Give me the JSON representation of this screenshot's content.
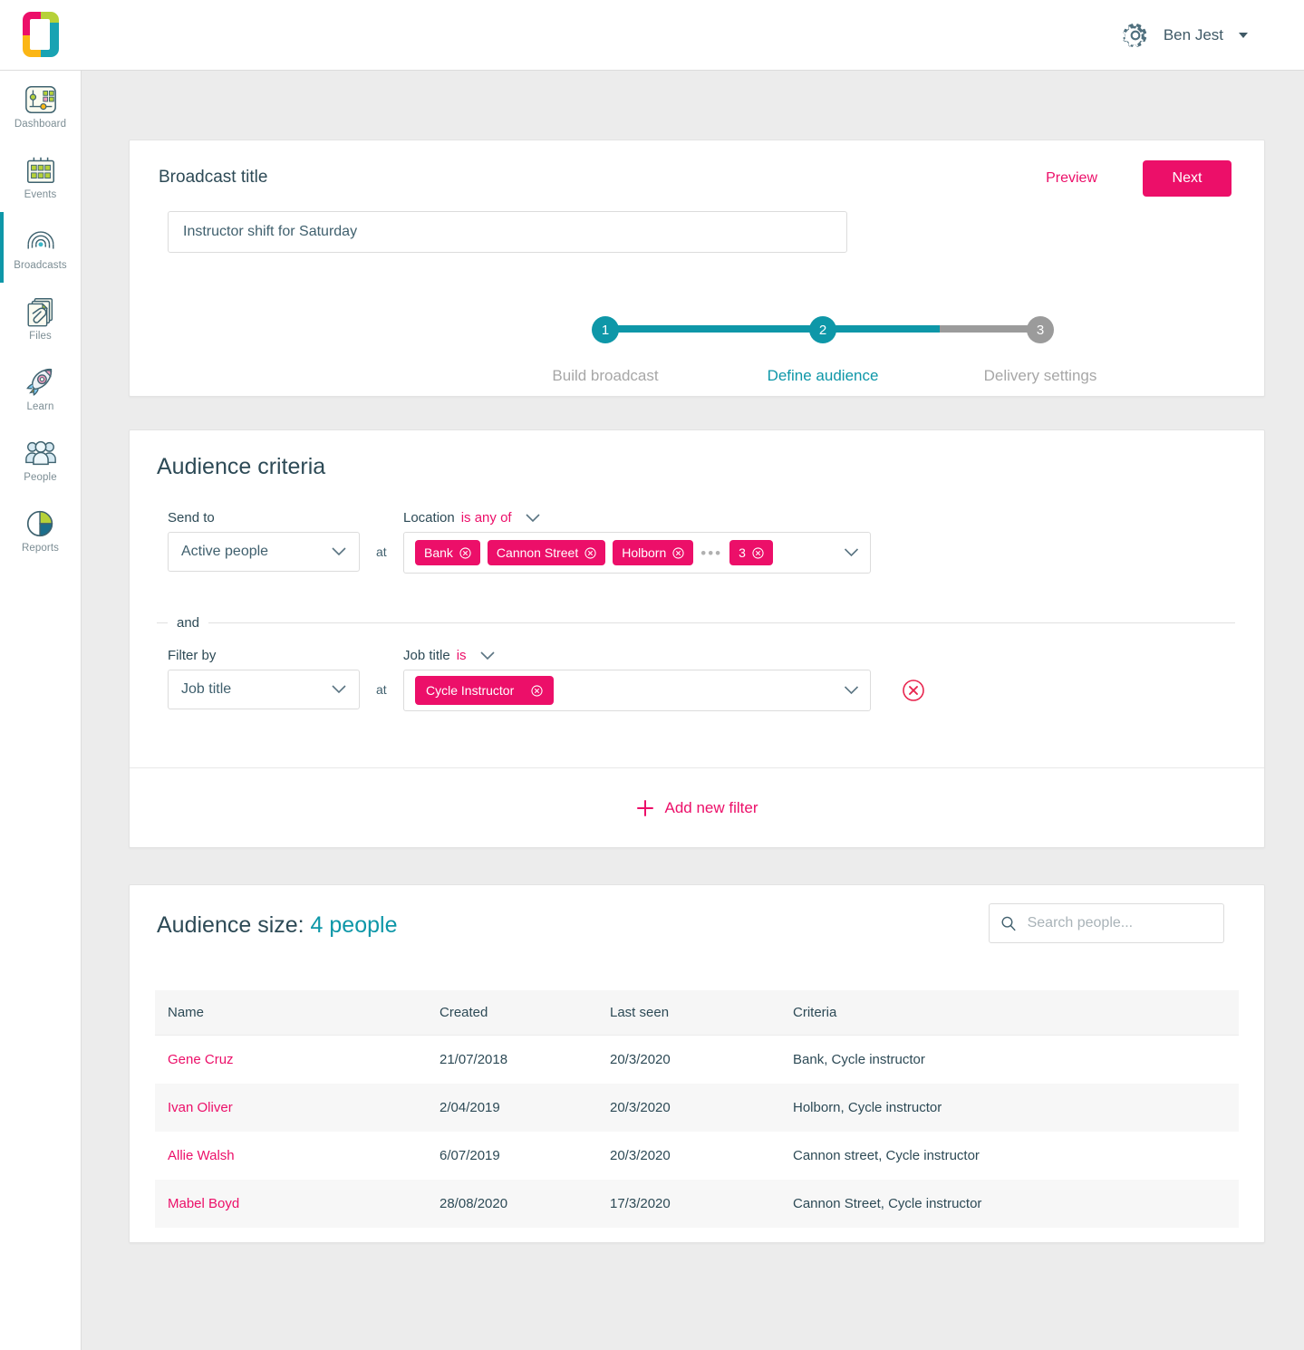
{
  "header": {
    "logo_name": "app-logo",
    "gear_icon": "gear-icon",
    "username": "Ben Jest"
  },
  "sidebar": {
    "items": [
      {
        "label": "Dashboard",
        "icon": "dashboard-icon",
        "active": false
      },
      {
        "label": "Events",
        "icon": "calendar-icon",
        "active": false
      },
      {
        "label": "Broadcasts",
        "icon": "broadcast-icon",
        "active": true
      },
      {
        "label": "Files",
        "icon": "files-icon",
        "active": false
      },
      {
        "label": "Learn",
        "icon": "rocket-icon",
        "active": false
      },
      {
        "label": "People",
        "icon": "people-icon",
        "active": false
      },
      {
        "label": "Reports",
        "icon": "pie-chart-icon",
        "active": false
      }
    ]
  },
  "broadcast": {
    "title_label": "Broadcast title",
    "title_value": "Instructor shift for Saturday",
    "title_placeholder": "Broadcast title",
    "preview_label": "Preview",
    "next_label": "Next",
    "steps": [
      {
        "number": "1",
        "label": "Build broadcast",
        "state": "complete"
      },
      {
        "number": "2",
        "label": "Define audience",
        "state": "current"
      },
      {
        "number": "3",
        "label": "Delivery settings",
        "state": "upcoming"
      }
    ]
  },
  "criteria": {
    "section_title": "Audience criteria",
    "and_text": "and",
    "at_text": "at",
    "add_filter_label": "Add new filter",
    "rows": [
      {
        "label": "Send to",
        "select_value": "Active people",
        "operator_field": "Location",
        "operator_value": "is any of",
        "chips": [
          "Bank",
          "Cannon Street",
          "Holborn"
        ],
        "overflow_dots": "•••",
        "overflow_count": "3",
        "removable": false
      },
      {
        "label": "Filter by",
        "select_value": "Job title",
        "operator_field": "Job title",
        "operator_value": "is",
        "chips": [
          "Cycle Instructor"
        ],
        "removable": true
      }
    ]
  },
  "audience": {
    "title_prefix": "Audience size: ",
    "count_text": "4 people",
    "search_placeholder": "Search people...",
    "search_value": "",
    "columns": [
      "Name",
      "Created",
      "Last seen",
      "Criteria"
    ],
    "rows": [
      {
        "name": "Gene Cruz",
        "created": "21/07/2018",
        "last_seen": "20/3/2020",
        "criteria": "Bank, Cycle instructor"
      },
      {
        "name": "Ivan Oliver",
        "created": "2/04/2019",
        "last_seen": "20/3/2020",
        "criteria": "Holborn, Cycle instructor"
      },
      {
        "name": "Allie Walsh",
        "created": "6/07/2019",
        "last_seen": "20/3/2020",
        "criteria": "Cannon street, Cycle instructor"
      },
      {
        "name": "Mabel Boyd",
        "created": "28/08/2020",
        "last_seen": "17/3/2020",
        "criteria": "Cannon Street, Cycle instructor"
      }
    ]
  },
  "colors": {
    "accent_pink": "#ec0f69",
    "accent_teal": "#0e97a8",
    "muted_gray": "#9b9b9b",
    "text_dark": "#2d4a56",
    "danger_red": "#e8254e"
  }
}
